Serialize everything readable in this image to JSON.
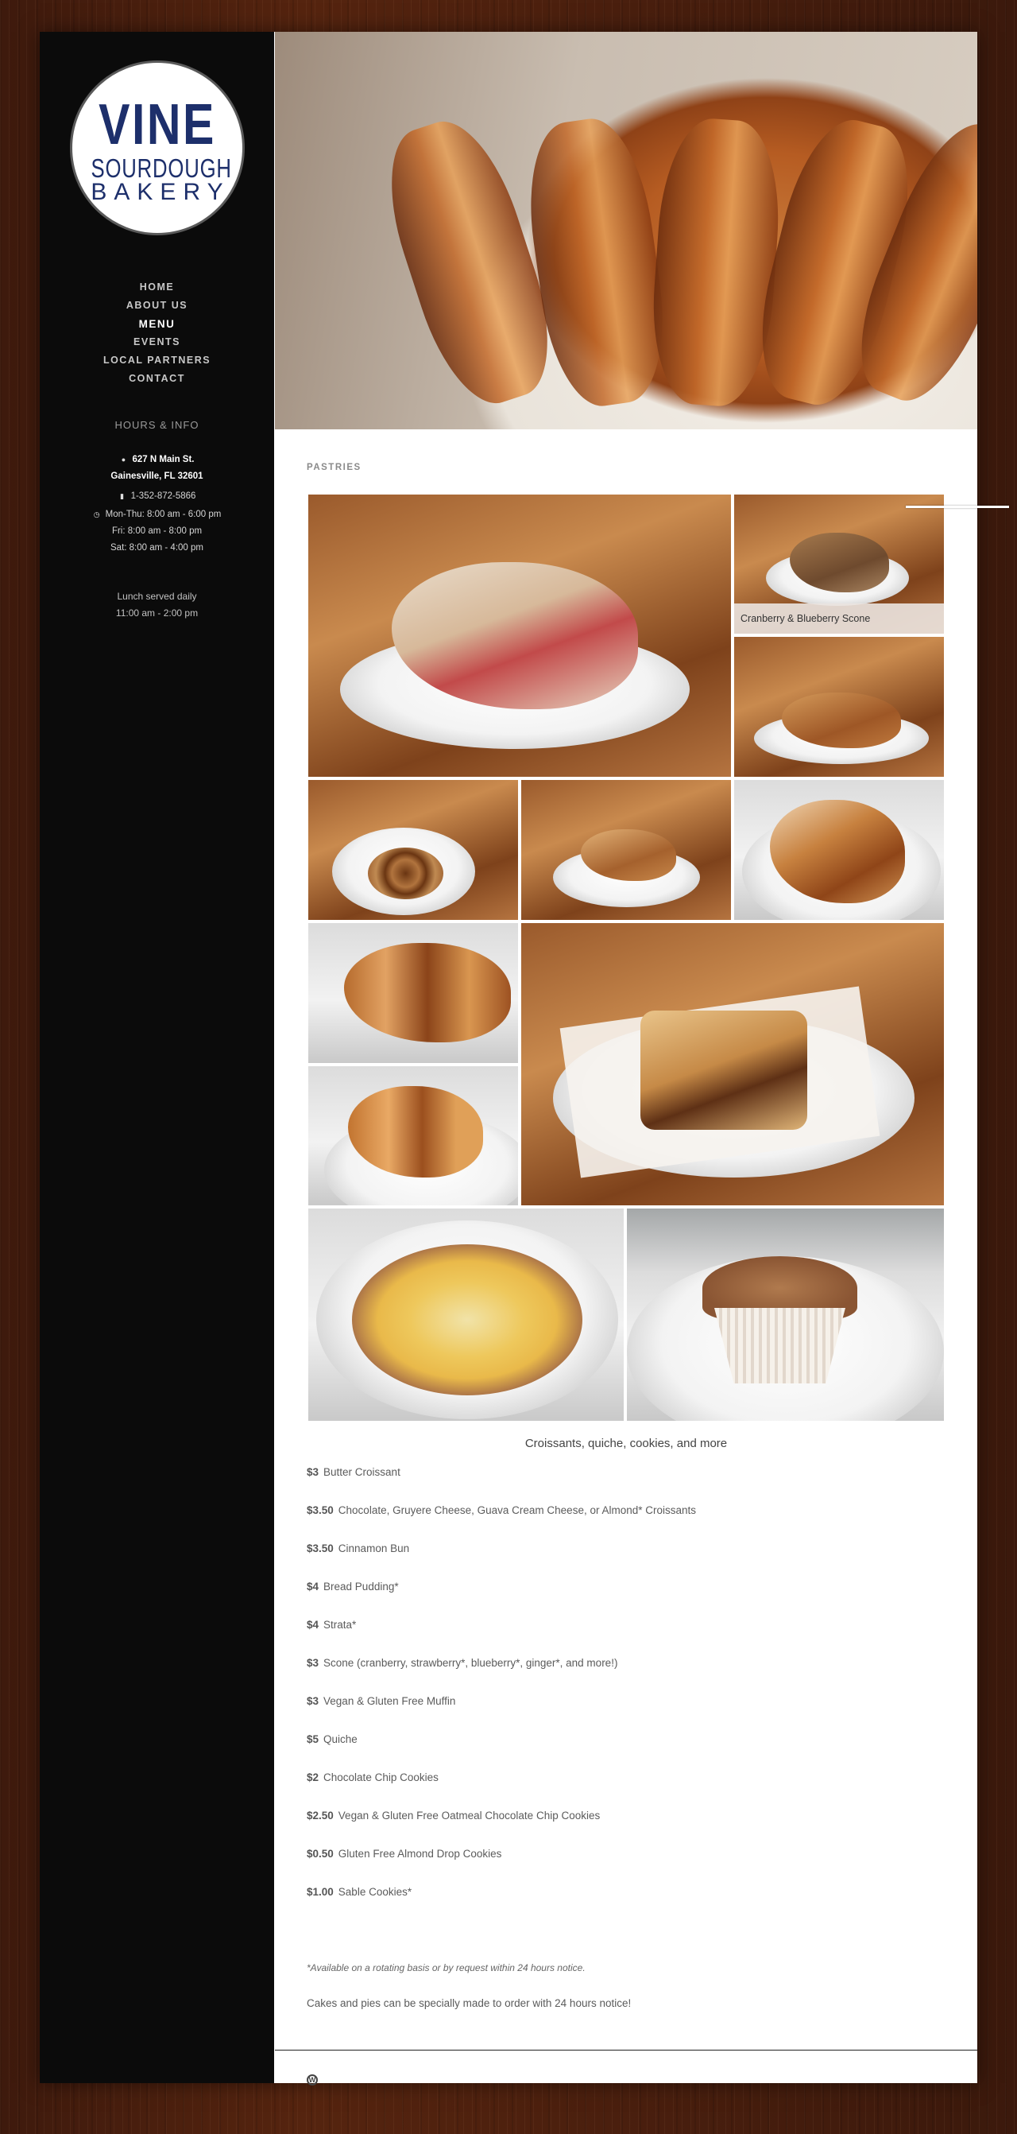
{
  "logo": {
    "line1": "VINE",
    "line2": "SOURDOUGH",
    "line3": "BAKERY"
  },
  "nav": [
    {
      "label": "HOME"
    },
    {
      "label": "ABOUT US"
    },
    {
      "label": "MENU"
    },
    {
      "label": "EVENTS"
    },
    {
      "label": "LOCAL PARTNERS"
    },
    {
      "label": "CONTACT"
    }
  ],
  "sidebar_info": {
    "heading": "HOURS & INFO",
    "address_line1": "627 N Main St.",
    "address_line2": "Gainesville, FL 32601",
    "phone": "1-352-872-5866",
    "hours": [
      "Mon-Thu: 8:00 am - 6:00 pm",
      "Fri: 8:00 am - 8:00 pm",
      "Sat: 8:00 am - 4:00 pm"
    ],
    "lunch_line1": "Lunch served daily",
    "lunch_line2": "11:00 am - 2:00 pm"
  },
  "section": {
    "title": "PASTRIES"
  },
  "gallery": {
    "scone_caption": "Cranberry & Blueberry Scone",
    "caption": "Croissants, quiche, cookies, and more"
  },
  "menu_items": [
    {
      "price": "$3",
      "name": "Butter Croissant"
    },
    {
      "price": "$3.50",
      "name": "Chocolate, Gruyere Cheese, Guava Cream Cheese, or Almond* Croissants"
    },
    {
      "price": "$3.50",
      "name": "Cinnamon Bun"
    },
    {
      "price": "$4",
      "name": "Bread Pudding*"
    },
    {
      "price": "$4",
      "name": "Strata*"
    },
    {
      "price": "$3",
      "name": "Scone (cranberry, strawberry*, blueberry*, ginger*, and more!)"
    },
    {
      "price": "$3",
      "name": "Vegan & Gluten Free Muffin"
    },
    {
      "price": "$5",
      "name": "Quiche"
    },
    {
      "price": "$2",
      "name": "Chocolate Chip Cookies"
    },
    {
      "price": "$2.50",
      "name": "Vegan & Gluten Free Oatmeal Chocolate Chip Cookies"
    },
    {
      "price": "$0.50",
      "name": "Gluten Free Almond Drop Cookies"
    },
    {
      "price": "$1.00",
      "name": "Sable Cookies*"
    }
  ],
  "footnote": "*Available on a rotating basis or by request within 24 hours notice.",
  "order_note": "Cakes and pies can be specially made to order with 24 hours notice!",
  "footer": {
    "wp_glyph": "W"
  }
}
